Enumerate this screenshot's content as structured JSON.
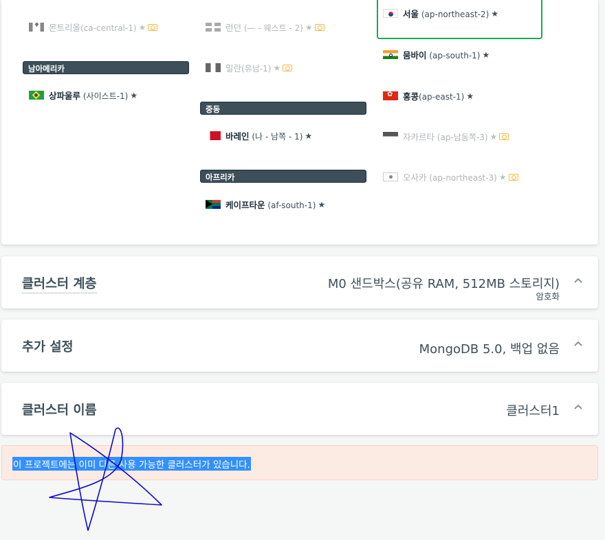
{
  "regions": {
    "selected_outline_color": "#13aa52",
    "groups": [
      {
        "label": "남아메리카"
      },
      {
        "label": "중동"
      },
      {
        "label": "아프리카"
      }
    ],
    "items": [
      {
        "flag": "ca",
        "name": "몬트리올",
        "code": "(ca-central-1)",
        "available": false
      },
      {
        "flag": "br",
        "name": "상파울루",
        "code": "(사이스트-1)",
        "available": true
      },
      {
        "flag": "gb",
        "name": "런던",
        "code": "(— - 웨스트 - 2)",
        "available": false
      },
      {
        "flag": "it",
        "name": "밀란",
        "code": "(유남-1)",
        "available": false
      },
      {
        "flag": "bh",
        "name": "바레인",
        "code": "(나 - 남쪽 - 1)",
        "available": true
      },
      {
        "flag": "za",
        "name": "케이프타운",
        "code": "(af-south-1)",
        "available": true
      },
      {
        "flag": "kr",
        "name": "서울",
        "code": "(ap-northeast-2)",
        "available": true,
        "selected": true
      },
      {
        "flag": "in",
        "name": "뭄바이",
        "code": "(ap-south-1)",
        "available": true
      },
      {
        "flag": "hk",
        "name": "홍콩",
        "code": "(ap-east-1)",
        "available": true
      },
      {
        "flag": "id",
        "name": "자카르타",
        "code": "(ap-남동쪽-3)",
        "available": false
      },
      {
        "flag": "jp",
        "name": "오사카",
        "code": "(ap-northeast-3)",
        "available": false
      }
    ]
  },
  "tier": {
    "title": "클러스터 계층",
    "value": "M0 샌드박스(공유 RAM, 512MB 스토리지)",
    "sub": "암호화"
  },
  "additional": {
    "title": "추가 설정",
    "value": "MongoDB 5.0, 백업 없음"
  },
  "cluster_name": {
    "title": "클러스터 이름",
    "value": "클러스터1"
  },
  "error": {
    "text": "이 프로젝트에는 이미 다른 사용 가능한 클러스터가 있습니다."
  },
  "icons": {
    "star": "star-icon",
    "free_tier": "free-tier-icon",
    "chevron": "chevron-up-icon"
  }
}
